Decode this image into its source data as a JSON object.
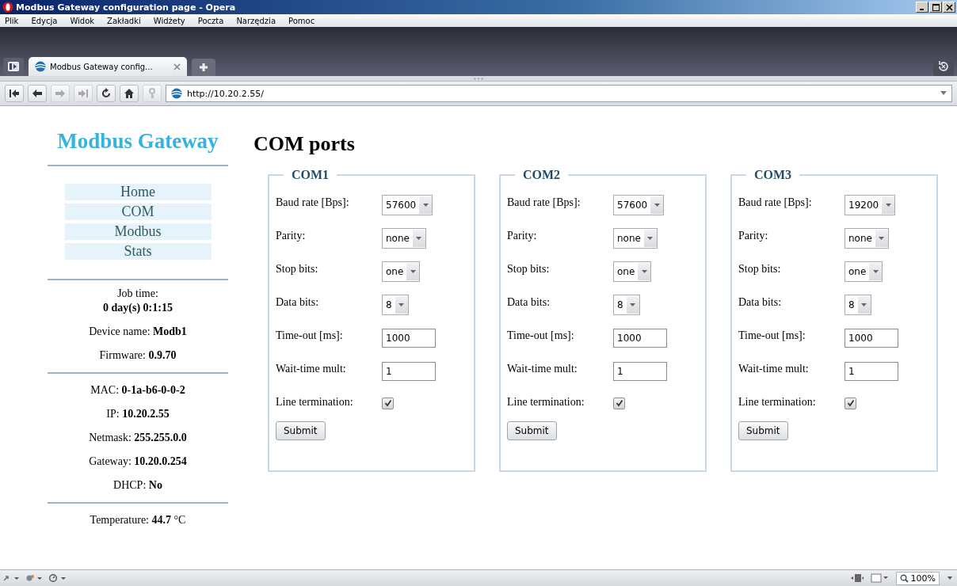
{
  "window": {
    "title": "Modbus Gateway configuration page - Opera"
  },
  "menu": [
    "Plik",
    "Edycja",
    "Widok",
    "Zakładki",
    "Widżety",
    "Poczta",
    "Narzędzia",
    "Pomoc"
  ],
  "tabs": [
    {
      "label": "Modbus Gateway config...",
      "selected": true
    }
  ],
  "address": "http://10.20.2.55/",
  "sidebar": {
    "title": "Modbus Gateway",
    "nav": [
      "Home",
      "COM",
      "Modbus",
      "Stats"
    ],
    "groups": [
      [
        {
          "kind": "stacked",
          "label": "Job time:",
          "value": "0 day(s) 0:1:15"
        },
        {
          "kind": "inline",
          "label": "Device name:",
          "value": "Modb1"
        },
        {
          "kind": "inline",
          "label": "Firmware:",
          "value": "0.9.70"
        }
      ],
      [
        {
          "kind": "inline",
          "label": "MAC:",
          "value": "0-1a-b6-0-0-2"
        },
        {
          "kind": "inline",
          "label": "IP:",
          "value": "10.20.2.55"
        },
        {
          "kind": "inline",
          "label": "Netmask:",
          "value": "255.255.0.0"
        },
        {
          "kind": "inline",
          "label": "Gateway:",
          "value": "10.20.0.254"
        },
        {
          "kind": "inline",
          "label": "DHCP:",
          "value": "No"
        }
      ],
      [
        {
          "kind": "inline",
          "label": "Temperature:",
          "value": "44.7",
          "unit": "°C"
        }
      ]
    ]
  },
  "main": {
    "title": "COM ports",
    "ports": [
      {
        "name": "COM1",
        "submit": "Submit",
        "fields": [
          {
            "kind": "select",
            "label": "Baud rate [Bps]:",
            "value": "57600"
          },
          {
            "kind": "select",
            "label": "Parity:",
            "value": "none"
          },
          {
            "kind": "select",
            "label": "Stop bits:",
            "value": "one"
          },
          {
            "kind": "select",
            "label": "Data bits:",
            "value": "8"
          },
          {
            "kind": "text",
            "label": "Time-out [ms]:",
            "value": "1000"
          },
          {
            "kind": "text",
            "label": "Wait-time mult:",
            "value": "1"
          },
          {
            "kind": "checkbox",
            "label": "Line termination:",
            "checked": true
          }
        ]
      },
      {
        "name": "COM2",
        "submit": "Submit",
        "fields": [
          {
            "kind": "select",
            "label": "Baud rate [Bps]:",
            "value": "57600"
          },
          {
            "kind": "select",
            "label": "Parity:",
            "value": "none"
          },
          {
            "kind": "select",
            "label": "Stop bits:",
            "value": "one"
          },
          {
            "kind": "select",
            "label": "Data bits:",
            "value": "8"
          },
          {
            "kind": "text",
            "label": "Time-out [ms]:",
            "value": "1000"
          },
          {
            "kind": "text",
            "label": "Wait-time mult:",
            "value": "1"
          },
          {
            "kind": "checkbox",
            "label": "Line termination:",
            "checked": true
          }
        ]
      },
      {
        "name": "COM3",
        "submit": "Submit",
        "fields": [
          {
            "kind": "select",
            "label": "Baud rate [Bps]:",
            "value": "19200"
          },
          {
            "kind": "select",
            "label": "Parity:",
            "value": "none"
          },
          {
            "kind": "select",
            "label": "Stop bits:",
            "value": "one"
          },
          {
            "kind": "select",
            "label": "Data bits:",
            "value": "8"
          },
          {
            "kind": "text",
            "label": "Time-out [ms]:",
            "value": "1000"
          },
          {
            "kind": "text",
            "label": "Wait-time mult:",
            "value": "1"
          },
          {
            "kind": "checkbox",
            "label": "Line termination:",
            "checked": true
          }
        ]
      }
    ]
  },
  "status_bar": {
    "zoom": "100%"
  }
}
